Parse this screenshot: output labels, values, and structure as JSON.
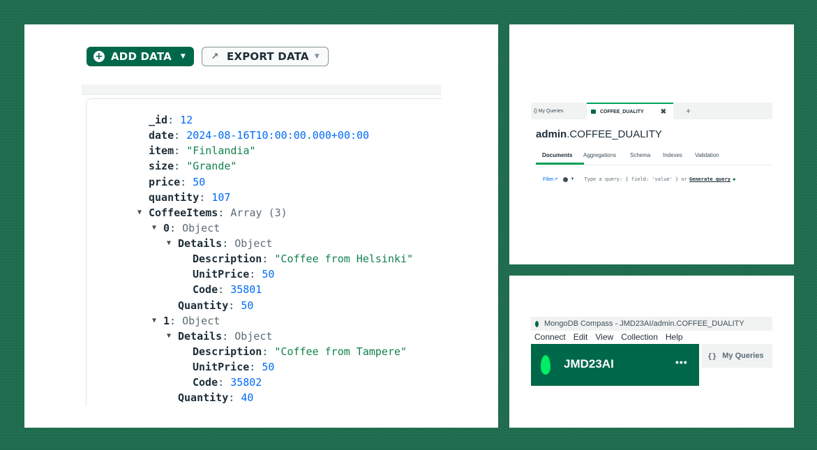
{
  "main": {
    "add_data_label": "ADD DATA",
    "export_data_label": "EXPORT DATA",
    "document": {
      "id_key": "_id",
      "id_val": "12",
      "date_key": "date",
      "date_val": "2024-08-16T10:00:00.000+00:00",
      "item_key": "item",
      "item_val": "\"Finlandia\"",
      "size_key": "size",
      "size_val": "\"Grande\"",
      "price_key": "price",
      "price_val": "50",
      "quantity_key": "quantity",
      "quantity_val": "107",
      "coffee_items_key": "CoffeeItems",
      "coffee_items_type": "Array (3)",
      "items": [
        {
          "index": "0",
          "type": "Object",
          "details_key": "Details",
          "details_type": "Object",
          "desc_key": "Description",
          "desc_val": "\"Coffee from Helsinki\"",
          "unit_key": "UnitPrice",
          "unit_val": "50",
          "code_key": "Code",
          "code_val": "35801",
          "qty_key": "Quantity",
          "qty_val": "50"
        },
        {
          "index": "1",
          "type": "Object",
          "details_key": "Details",
          "details_type": "Object",
          "desc_key": "Description",
          "desc_val": "\"Coffee from Tampere\"",
          "unit_key": "UnitPrice",
          "unit_val": "50",
          "code_key": "Code",
          "code_val": "35802",
          "qty_key": "Quantity",
          "qty_val": "40"
        }
      ]
    }
  },
  "tabs_panel": {
    "my_queries_tab": "{} My Queries",
    "active_tab": "COFFEE_DUALITY",
    "close_glyph": "✖",
    "add_glyph": "+",
    "title_db": "admin",
    "title_coll": ".COFFEE_DUALITY",
    "subtabs": [
      "Documents",
      "Aggregations",
      "Schema",
      "Indexes",
      "Validation"
    ],
    "filter_label": "Filter",
    "query_placeholder": "Type a query: { field: 'value' } or",
    "generate_query": "Generate query"
  },
  "compass_panel": {
    "window_title": "MongoDB Compass - JMD23AI/admin.COFFEE_DUALITY",
    "menu": [
      "Connect",
      "Edit",
      "View",
      "Collection",
      "Help"
    ],
    "connection_name": "JMD23AI",
    "more_glyph": "•••",
    "my_queries_brace": "{}",
    "my_queries_label": "My Queries"
  },
  "colors": {
    "background": "#1f6b4d",
    "brand_green": "#00684a",
    "leaf_green": "#00ed64",
    "key_text": "#1c2d38",
    "number_blue": "#016bf8",
    "string_green": "#12824d"
  }
}
